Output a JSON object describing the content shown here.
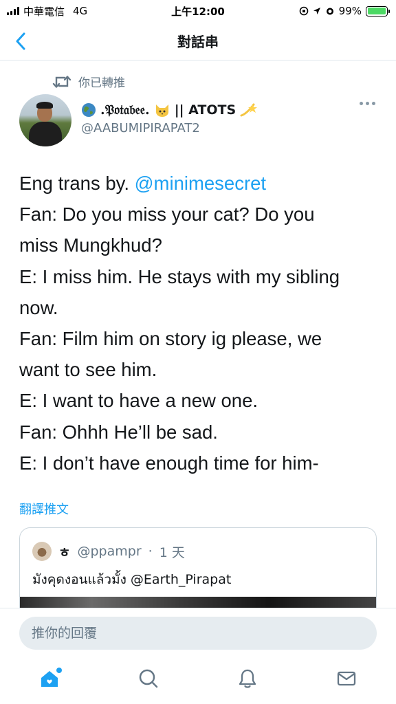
{
  "status_bar": {
    "carrier": "中華電信",
    "network": "4G",
    "time": "上午12:00",
    "battery": "99%",
    "battery_level": 0.99
  },
  "nav": {
    "title": "對話串"
  },
  "retweet_context": {
    "label": "你已轉推"
  },
  "tweet": {
    "author": {
      "display_name": ".𝔓𝔬𝔱𝔞𝔟𝔢𝔢.",
      "display_suffix": "|| ATOTS",
      "handle": "@AABUMIPIRAPAT2"
    },
    "lines": [
      {
        "before": "Eng trans by. ",
        "mention": "@minimesecret"
      },
      {
        "text": "Fan: Do you miss your cat? Do you"
      },
      {
        "text": "miss Mungkhud?"
      },
      {
        "text": "E: I miss him. He stays with my sibling"
      },
      {
        "text": "now."
      },
      {
        "text": "Fan: Film him on story ig please, we"
      },
      {
        "text": "want to see him."
      },
      {
        "text": "E: I want to have a new one."
      },
      {
        "text": "Fan: Ohhh He’ll be sad."
      },
      {
        "text": "E: I don’t have enough time for him-"
      }
    ],
    "translate_label": "翻譯推文"
  },
  "quoted_tweet": {
    "name": "ㅎ",
    "handle": "@ppampr",
    "separator": "·",
    "time": "1 天",
    "text": "มังคุดงอนแล้วมั้ง @Earth_Pirapat"
  },
  "reply": {
    "placeholder": "推你的回覆"
  },
  "tabs": [
    {
      "icon": "home-icon",
      "active": true
    },
    {
      "icon": "search-icon"
    },
    {
      "icon": "bell-icon"
    },
    {
      "icon": "mail-icon"
    }
  ],
  "colors": {
    "accent": "#1da1f2",
    "secondary_text": "#657786",
    "primary_text": "#14171a",
    "battery_fill": "#4cd964"
  }
}
